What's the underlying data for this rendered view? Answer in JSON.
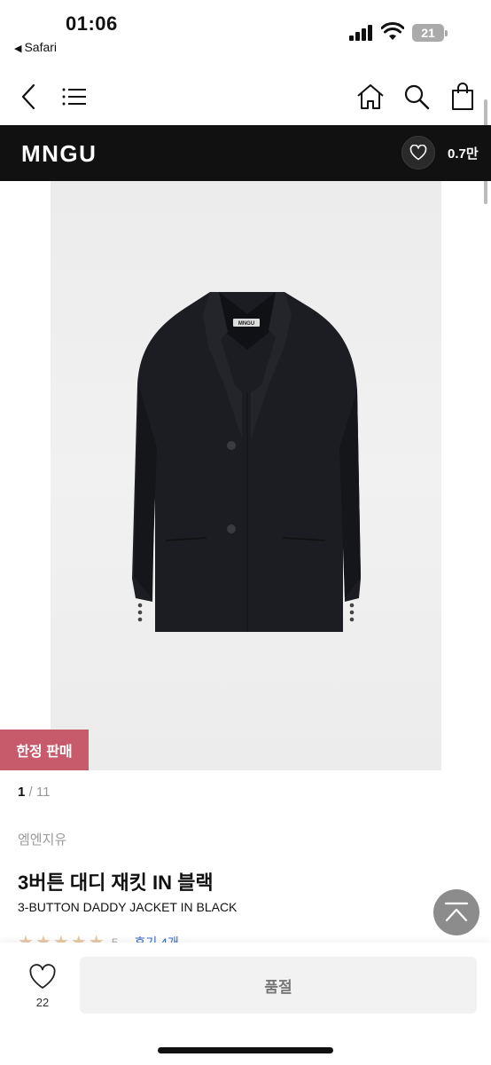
{
  "status_bar": {
    "time": "01:06",
    "back_app": "Safari",
    "battery": "21"
  },
  "nav": {
    "icons": [
      "back-icon",
      "menu-icon",
      "home-icon",
      "search-icon",
      "cart-icon"
    ]
  },
  "brand": {
    "name": "MNGU",
    "like_count": "0.7만"
  },
  "product": {
    "image_label": "MNGU",
    "badge": "한정 판매",
    "page_current": "1",
    "page_separator": " / ",
    "page_total": "11",
    "brand_label": "엠엔지유",
    "title": "3버튼 대디 재킷 IN 블랙",
    "subtitle": "3-BUTTON DADDY JACKET IN BLACK",
    "rating_score": "5",
    "review_text": "후기 4개",
    "rating": 5,
    "accent_color": "#c75b6b"
  },
  "bottom_bar": {
    "like_count": "22",
    "soldout_label": "품절"
  }
}
